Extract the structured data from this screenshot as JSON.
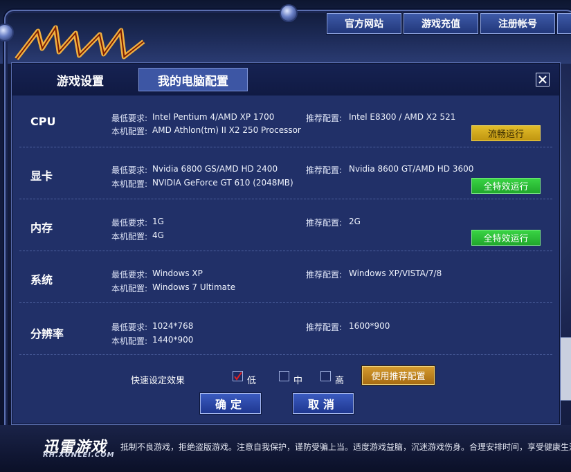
{
  "launcher": {
    "nav": [
      "官方网站",
      "游戏充值",
      "注册帐号",
      ""
    ],
    "brand": "迅雷游戏",
    "brand_sub": "RH.XUNLEI.COM",
    "notice": "抵制不良游戏，拒绝盗版游戏。注意自我保护，谨防受骗上当。适度游戏益脑，沉迷游戏伤身。合理安排时间，享受健康生活"
  },
  "dialog": {
    "tabs": [
      "游戏设置",
      "我的电脑配置"
    ],
    "close_icon": "close-icon",
    "rows": [
      {
        "category": "CPU",
        "min_label": "最低要求:",
        "min_value": "Intel Pentium 4/AMD XP 1700",
        "local_label": "本机配置:",
        "local_value": "AMD Athlon(tm) II X2 250 Processor",
        "rec_label": "推荐配置:",
        "rec_value": "Intel E8300 / AMD X2 521",
        "status": "流畅运行",
        "status_color": "#d4ad1c"
      },
      {
        "category": "显卡",
        "min_label": "最低要求:",
        "min_value": "Nvidia 6800 GS/AMD HD 2400",
        "local_label": "本机配置:",
        "local_value": "NVIDIA GeForce GT 610 (2048MB)",
        "rec_label": "推荐配置:",
        "rec_value": "Nvidia 8600 GT/AMD HD 3600",
        "status": "全特效运行",
        "status_color": "#2dbd37"
      },
      {
        "category": "内存",
        "min_label": "最低要求:",
        "min_value": "1G",
        "local_label": "本机配置:",
        "local_value": "4G",
        "rec_label": "推荐配置:",
        "rec_value": "2G",
        "status": "全特效运行",
        "status_color": "#2dbd37"
      },
      {
        "category": "系统",
        "min_label": "最低要求:",
        "min_value": "Windows XP",
        "local_label": "本机配置:",
        "local_value": "Windows 7 Ultimate",
        "rec_label": "推荐配置:",
        "rec_value": "Windows XP/VISTA/7/8",
        "status": "",
        "status_color": ""
      },
      {
        "category": "分辨率",
        "min_label": "最低要求:",
        "min_value": "1024*768",
        "local_label": "本机配置:",
        "local_value": "1440*900",
        "rec_label": "推荐配置:",
        "rec_value": "1600*900",
        "status": "",
        "status_color": ""
      }
    ],
    "quick": {
      "label": "快速设定效果",
      "options": [
        {
          "label": "低",
          "checked": true
        },
        {
          "label": "中",
          "checked": false
        },
        {
          "label": "高",
          "checked": false
        }
      ],
      "recommend_button": "使用推荐配置"
    },
    "ok_button": "确定",
    "cancel_button": "取消"
  },
  "colors": {
    "dialog_bg": "#213068",
    "check_mark": "#e02020"
  }
}
